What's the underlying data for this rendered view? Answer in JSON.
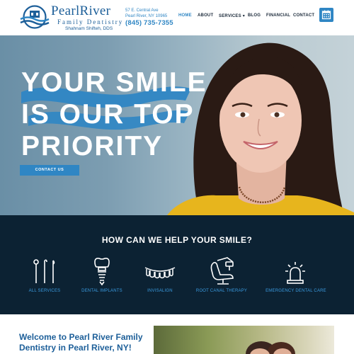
{
  "header": {
    "brand_name": "PearlRiver",
    "brand_sub": "Family Dentistry",
    "doctor": "Shahnam Shifteh, DDS",
    "address_line1": "57 E. Central Ave",
    "address_line2": "Pearl River, NY 10965",
    "phone": "(845) 735-7355",
    "nav": [
      {
        "label": "HOME",
        "active": true
      },
      {
        "label": "ABOUT"
      },
      {
        "label": "SERVICES ▾"
      },
      {
        "label": "BLOG"
      },
      {
        "label": "FINANCIAL"
      },
      {
        "label": "CONTACT"
      }
    ],
    "calendar_icon": "calendar-icon"
  },
  "hero": {
    "line1": "YOUR SMILE",
    "line2": "IS OUR TOP",
    "line3": "PRIORITY",
    "cta": "CONTACT US"
  },
  "services": {
    "title": "HOW CAN WE HELP YOUR SMILE?",
    "items": [
      {
        "label": "ALL SERVICES",
        "icon": "dental-tools-icon"
      },
      {
        "label": "DENTAL IMPLANTS",
        "icon": "implant-icon"
      },
      {
        "label": "INVISALIGN",
        "icon": "teeth-aligner-icon"
      },
      {
        "label": "ROOT CANAL THERAPY",
        "icon": "dental-chair-icon"
      },
      {
        "label": "EMERGENCY DENTAL CARE",
        "icon": "siren-icon"
      }
    ]
  },
  "welcome": {
    "line1": "Welcome to Pearl River Family",
    "line2": "Dentistry in Pearl River, NY!"
  },
  "colors": {
    "brand_blue": "#1d5f99",
    "accent_blue": "#2f86c4",
    "dark_band": "#0c2233",
    "service_label": "#3a9be0"
  }
}
